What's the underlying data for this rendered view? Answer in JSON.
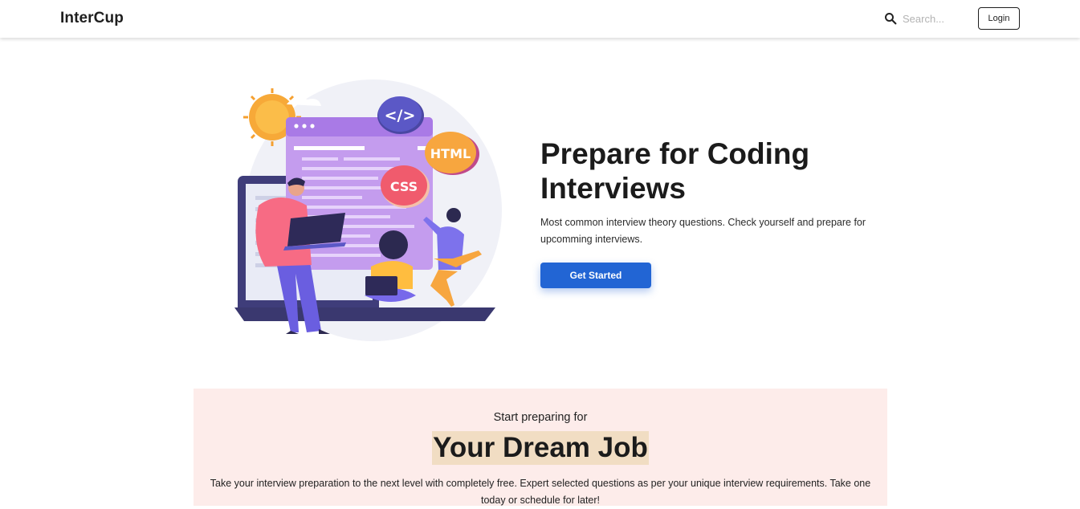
{
  "navbar": {
    "brand": "InterCup",
    "search_placeholder": "Search...",
    "login_label": "Login"
  },
  "hero": {
    "title": "Prepare for Coding Interviews",
    "subtitle": "Most common interview theory questions. Check yourself and prepare for upcomming interviews.",
    "cta_label": "Get Started",
    "illustration": {
      "code_badge": "</>",
      "html_badge": "HTML",
      "css_badge": "CSS"
    }
  },
  "dream": {
    "pretitle": "Start preparing for",
    "title": "Your Dream Job",
    "description": "Take your interview preparation to the next level with completely free. Expert selected questions as per your unique interview requirements. Take one today or schedule for later!"
  },
  "colors": {
    "primary": "#2265d4",
    "section_bg": "#fdecea",
    "highlight": "#f1ddc3"
  }
}
